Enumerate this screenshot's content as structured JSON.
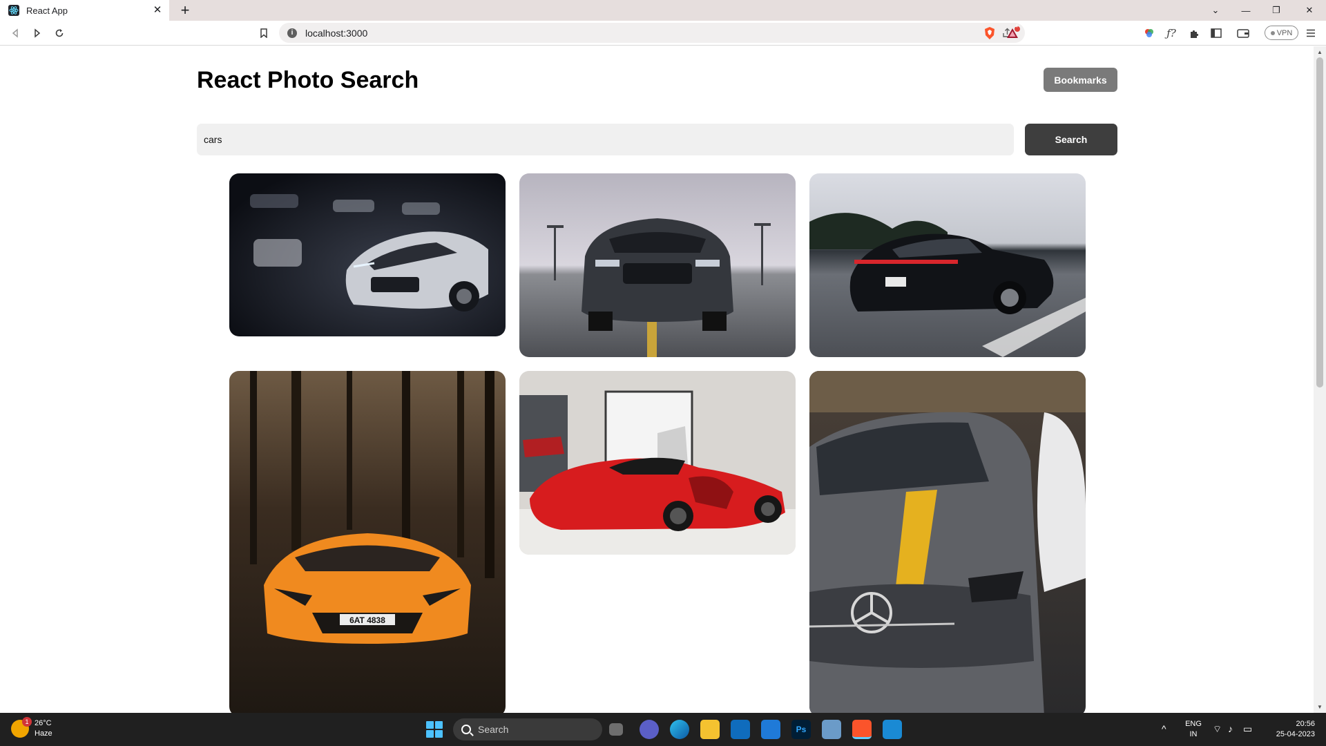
{
  "browser": {
    "tab_title": "React App",
    "tab_close": "✕",
    "new_tab": "+",
    "url": "localhost:3000",
    "vpn_label": "VPN",
    "brave_badge": "4"
  },
  "app": {
    "title": "React Photo Search",
    "bookmarks_label": "Bookmarks",
    "search_value": "cars",
    "search_button_label": "Search"
  },
  "photos": [
    {
      "subject": "white sports car in dark garage"
    },
    {
      "subject": "dark muscle car front view on road"
    },
    {
      "subject": "black sports sedan driving on highway"
    },
    {
      "subject": "orange supercar in forest"
    },
    {
      "subject": "red hypercar in showroom"
    },
    {
      "subject": "grey sedan with yellow stripe"
    }
  ],
  "taskbar": {
    "weather_temp": "26°C",
    "weather_desc": "Haze",
    "weather_badge": "1",
    "search_label": "Search",
    "lang_line1": "ENG",
    "lang_line2": "IN",
    "time": "20:56",
    "date": "25-04-2023"
  },
  "colors": {
    "bookmarks_button": "#7a7a7a",
    "search_button": "#3e3e3e",
    "search_input_bg": "#f0f0f0",
    "taskbar_bg": "#202020"
  }
}
